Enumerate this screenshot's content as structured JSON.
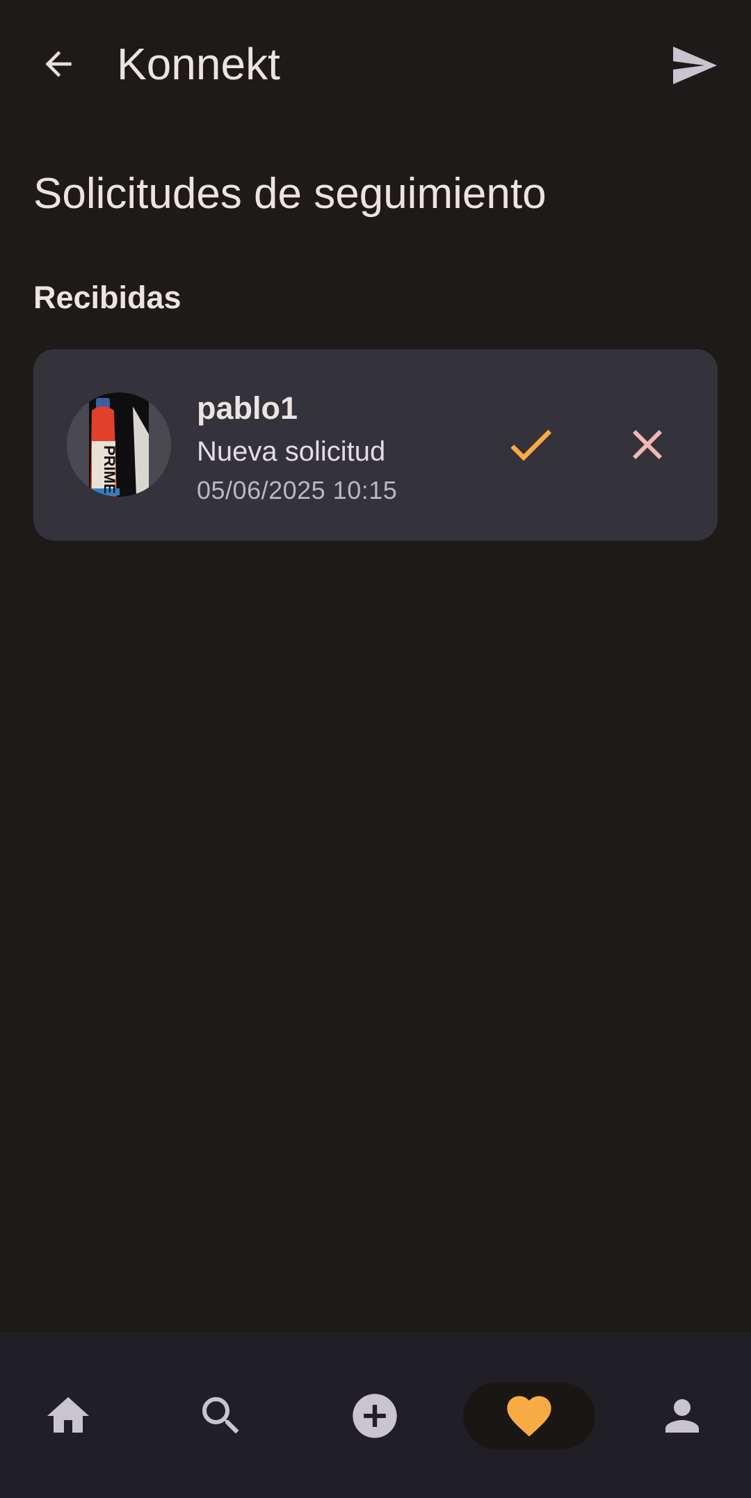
{
  "app": {
    "title": "Konnekt"
  },
  "page": {
    "title": "Solicitudes de seguimiento",
    "section_received": "Recibidas"
  },
  "requests": [
    {
      "username": "pablo1",
      "message": "Nueva solicitud",
      "timestamp": "05/06/2025 10:15",
      "avatar_text": "PRIME"
    }
  ],
  "icons": {
    "back": "arrow-left-icon",
    "send": "send-icon",
    "accept": "check-icon",
    "reject": "close-icon",
    "nav_home": "home-icon",
    "nav_search": "search-icon",
    "nav_add": "add-circle-icon",
    "nav_activity": "heart-icon",
    "nav_profile": "person-icon"
  },
  "colors": {
    "background": "#1e1a19",
    "card": "#34323b",
    "accent": "#f9ab43",
    "reject": "#f2b8b5",
    "nav_background": "#211f26",
    "nav_icon": "#cac4d0"
  },
  "bottom_nav": {
    "active": "activity"
  }
}
